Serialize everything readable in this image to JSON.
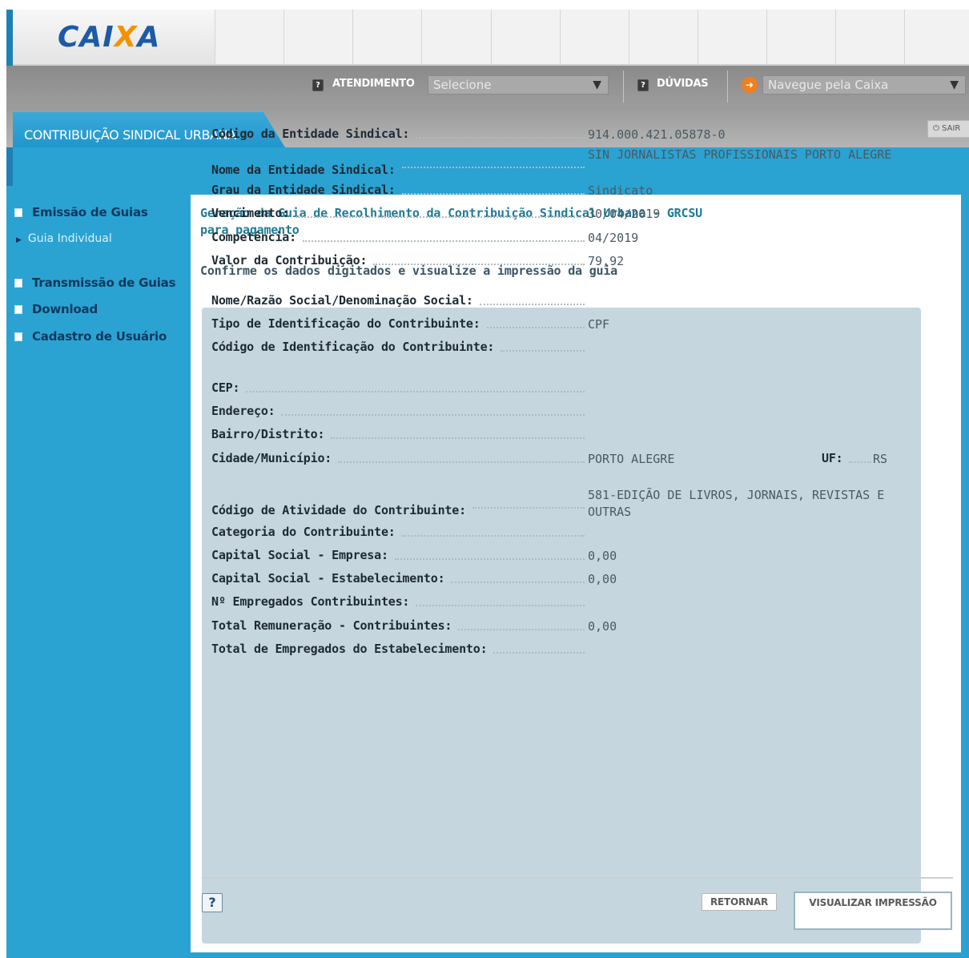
{
  "header": {
    "logo_text": "CAIXA",
    "brand_colors": {
      "blue": "#1d5aa6",
      "orange": "#f39200"
    }
  },
  "toolbar": {
    "atendimento_label": "ATENDIMENTO",
    "atendimento_select": "Selecione",
    "duvidas_label": "DÚVIDAS",
    "navegue_select": "Navegue pela Caixa",
    "icons": [
      "help-icon",
      "help-icon",
      "arrow-right-icon"
    ]
  },
  "tab": {
    "label": "CONTRIBUIÇÃO SINDICAL URBANA",
    "exit_label": "SAIR"
  },
  "sidebar": {
    "items": [
      {
        "label": "Emissão de Guias"
      },
      {
        "label": "Transmissão de Guias"
      },
      {
        "label": "Download"
      },
      {
        "label": "Cadastro de Usuário"
      }
    ],
    "subitem": "Guia Individual"
  },
  "main": {
    "title_line1": "Geração da Guia de Recolhimento da Contribuição Sindical Urbana - GRCSU",
    "title_line2": "para pagamento",
    "instruction": "Confirme os dados digitados e visualize a impressão da guia",
    "fields": [
      {
        "label": "Código da Entidade Sindical:",
        "value": "914.000.421.05878-0"
      },
      {
        "label": "Nome da Entidade Sindical:",
        "value": "SIN JORNALISTAS PROFISSIONAIS PORTO ALEGRE"
      },
      {
        "label": "Grau da Entidade Sindical:",
        "value": "Sindicato"
      },
      {
        "label": "Vencimento:",
        "value": "30/04/2019"
      },
      {
        "label": "Competência:",
        "value": "04/2019"
      },
      {
        "label": "Valor da Contribuição:",
        "value": "79,92"
      },
      {
        "label": "Nome/Razão Social/Denominação Social:",
        "value": ""
      },
      {
        "label": "Tipo de Identificação do Contribuinte:",
        "value": "CPF"
      },
      {
        "label": "Código de Identificação do Contribuinte:",
        "value": ""
      },
      {
        "label": "CEP:",
        "value": ""
      },
      {
        "label": "Endereço:",
        "value": ""
      },
      {
        "label": "Bairro/Distrito:",
        "value": ""
      },
      {
        "label": "Cidade/Município:",
        "value": "PORTO ALEGRE"
      },
      {
        "label": "Código de Atividade do Contribuinte:",
        "value": "581-EDIÇÃO DE LIVROS, JORNAIS, REVISTAS E OUTRAS"
      },
      {
        "label": "Categoria do Contribuinte:",
        "value": ""
      },
      {
        "label": "Capital Social - Empresa:",
        "value": "0,00"
      },
      {
        "label": "Capital Social - Estabelecimento:",
        "value": "0,00"
      },
      {
        "label": "Nº Empregados Contribuintes:",
        "value": ""
      },
      {
        "label": "Total Remuneração - Contribuintes:",
        "value": "0,00"
      },
      {
        "label": "Total de Empregados do Estabelecimento:",
        "value": ""
      }
    ],
    "uf_label": "UF:",
    "uf_value": "RS"
  },
  "footer": {
    "help_label": "?",
    "retornar_label": "RETORNAR",
    "visualizar_label": "VISUALIZAR IMPRESSÃO"
  }
}
